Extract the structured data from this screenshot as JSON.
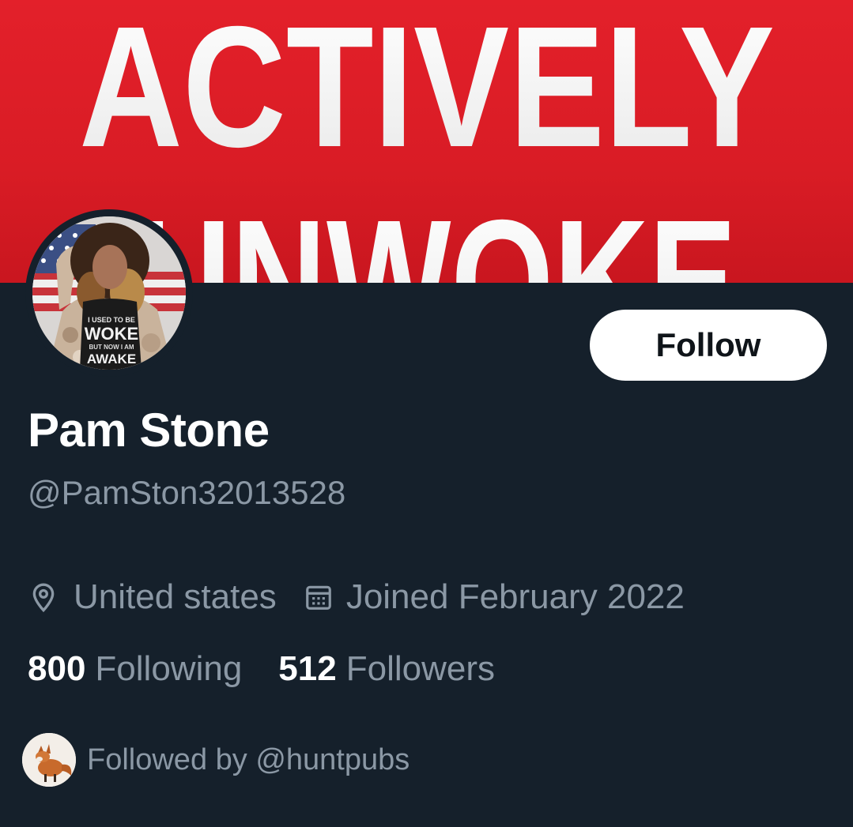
{
  "banner": {
    "line1": "ACTIVELY",
    "line2": "UNWOKE"
  },
  "avatar": {
    "shirt_line1": "I USED TO BE",
    "shirt_line2": "WOKE",
    "shirt_line3": "BUT NOW I AM",
    "shirt_line4": "AWAKE"
  },
  "profile": {
    "follow_label": "Follow",
    "display_name": "Pam Stone",
    "handle": "@PamSton32013528",
    "location": "United states",
    "joined": "Joined February 2022",
    "following_count": "800",
    "following_label": "Following",
    "followers_count": "512",
    "followers_label": "Followers",
    "followed_by": "Followed by @huntpubs"
  },
  "icons": {
    "location": "location-pin-icon",
    "joined": "calendar-icon"
  },
  "colors": {
    "background": "#15202b",
    "banner_red": "#e3202a",
    "secondary_text": "#8b98a5",
    "primary_text": "#ffffff",
    "follow_button_bg": "#ffffff",
    "follow_button_text": "#0f1419"
  }
}
